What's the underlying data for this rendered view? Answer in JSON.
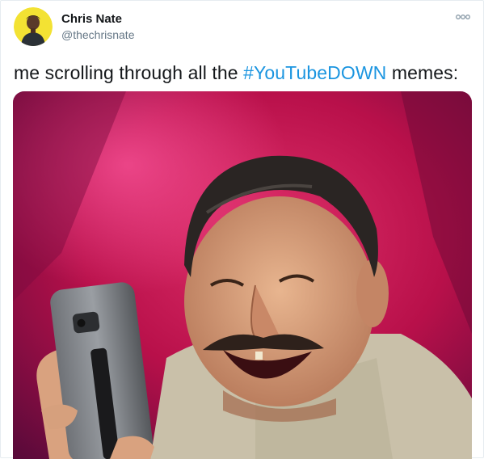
{
  "tweet": {
    "author_name": "Chris Nate",
    "author_handle": "@thechrisnate",
    "text_before": "me scrolling through all the ",
    "hashtag": "#YouTubeDOWN",
    "text_after": " memes:"
  },
  "icons": {
    "more": "more-options-icon",
    "avatar": "user-avatar"
  },
  "colors": {
    "hashtag": "#1b95e0",
    "name": "#14171a",
    "handle": "#657786",
    "avatar_bg": "#f5e23a",
    "media_bg": "#c4104f"
  }
}
